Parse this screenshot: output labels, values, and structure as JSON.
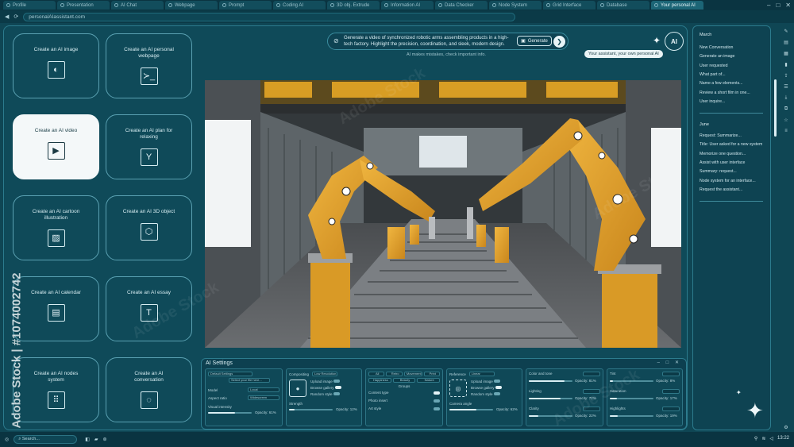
{
  "browser": {
    "tabs": [
      "Profile",
      "Presentation",
      "AI Chat",
      "Webpage",
      "Prompt",
      "Coding AI",
      "3D obj. Extrude",
      "Information AI",
      "Data Checker",
      "Node System",
      "Grid Interface",
      "Database",
      "Your personal AI"
    ],
    "active_tab_index": 12,
    "url": "personalAIassistant.com"
  },
  "tools": [
    {
      "label": "Create an AI image",
      "icon": "image-icon",
      "selected": false
    },
    {
      "label": "Create an AI personal webpage",
      "icon": "terminal-icon",
      "selected": false
    },
    {
      "label": "Create an AI video",
      "icon": "play-icon",
      "selected": true
    },
    {
      "label": "Create an AI plan for relaxing",
      "icon": "cocktail-icon",
      "selected": false
    },
    {
      "label": "Create an AI cartoon illustration",
      "icon": "illustration-icon",
      "selected": false
    },
    {
      "label": "Create an AI 3D object",
      "icon": "cube-icon",
      "selected": false
    },
    {
      "label": "Create an AI calendar",
      "icon": "calendar-icon",
      "selected": false
    },
    {
      "label": "Create an AI essay",
      "icon": "text-icon",
      "selected": false
    },
    {
      "label": "Create an AI nodes system",
      "icon": "nodes-icon",
      "selected": false
    },
    {
      "label": "Create an AI conversation",
      "icon": "conversation-icon",
      "selected": false
    }
  ],
  "prompt": {
    "text": "Generate a video of synchronized robotic arms assembling products in a high-tech factory. Highlight the precision, coordination, and sleek, modern design.",
    "generate_label": "Generate",
    "disclaimer": "AI makes mistakes, check important info."
  },
  "brand": {
    "logo_text": "AI",
    "tagline": "Your assistant, your own personal AI"
  },
  "settings": {
    "title": "AI Settings",
    "panel1": {
      "search_placeholder": "Default Settings",
      "field2": "Select your file here...",
      "model_label": "Model",
      "model_value": "Local",
      "aspect_label": "Aspect ratio",
      "aspect_value": "Widescreen",
      "visual_label": "Visual intensity",
      "opacity": "Opacity: 61%"
    },
    "panel2": {
      "title": "Compositing",
      "dropdown": "Low Resolution",
      "opt1": "Upload image",
      "opt2": "Browse gallery",
      "opt3": "Random style",
      "strength_label": "Strength",
      "opacity": "Opacity: 12%",
      "toggle_states": [
        false,
        true,
        false
      ]
    },
    "panel3": {
      "tags_row1": [
        "All",
        "Retro",
        "Movement",
        "Print"
      ],
      "tags_row2": [
        "Happiness",
        "Beauty",
        "Nature"
      ],
      "group": "Groups",
      "rows": [
        "Content type",
        "Photo insert",
        "Art style"
      ],
      "toggle_states": [
        true,
        false,
        false
      ]
    },
    "panel4": {
      "title": "Reference",
      "dropdown": "Linear",
      "opt1": "Upload image",
      "opt2": "Browse gallery",
      "opt3": "Random style",
      "angle_label": "Camera angle",
      "opacity": "Opacity: 62%",
      "toggle_states": [
        false,
        true,
        false
      ]
    },
    "panel5": [
      {
        "label": "Color and tone",
        "opacity": "Opacity: 81%",
        "fill": 0.81
      },
      {
        "label": "Lighting",
        "opacity": "Opacity: 72%",
        "fill": 0.72
      },
      {
        "label": "Clarity",
        "opacity": "Opacity: 22%",
        "fill": 0.22
      }
    ],
    "panel6": [
      {
        "label": "Tint",
        "opacity": "Opacity: 8%",
        "fill": 0.08
      },
      {
        "label": "Saturation",
        "opacity": "Opacity: 17%",
        "fill": 0.17
      },
      {
        "label": "Highlights",
        "opacity": "Opacity: 19%",
        "fill": 0.19
      }
    ]
  },
  "history": {
    "group1": "March",
    "group1_items": [
      "New Conversation",
      "Generate an image",
      "User requested",
      "What part of...",
      "Name a few elements...",
      "Review a short film in one...",
      "User inquire..."
    ],
    "group2": "June",
    "group2_items": [
      "Request: Summarize...",
      "Title: User asked for a new system",
      "Memorize one question...",
      "Assist with user interface",
      "Summary: request...",
      "Node system for an interface...",
      "Request the assistant..."
    ]
  },
  "taskbar": {
    "search": "Search...",
    "time": "13:22"
  },
  "watermark": {
    "side": "Adobe Stock | #1074002742",
    "diag": "Adobe Stock"
  },
  "colors": {
    "bg": "#0f4654",
    "accent": "#2c7b8d",
    "selected_card": "#f4f8f9",
    "robot": "#e3a028"
  }
}
